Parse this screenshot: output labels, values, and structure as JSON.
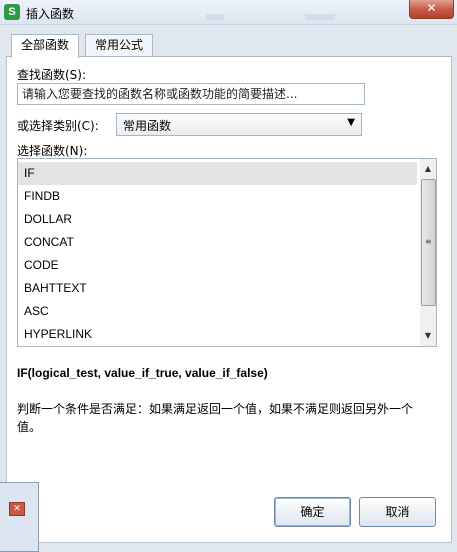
{
  "window": {
    "title": "插入函数",
    "close_glyph": "✕"
  },
  "tabs": [
    {
      "label": "全部函数",
      "active": true
    },
    {
      "label": "常用公式",
      "active": false
    }
  ],
  "search": {
    "label": "查找函数(S):",
    "placeholder": "请输入您要查找的函数名称或函数功能的简要描述..."
  },
  "category": {
    "label": "或选择类别(C):",
    "value": "常用函数"
  },
  "function_list": {
    "label": "选择函数(N):",
    "items": [
      "IF",
      "FINDB",
      "DOLLAR",
      "CONCAT",
      "CODE",
      "BAHTTEXT",
      "ASC",
      "HYPERLINK"
    ],
    "selected": "IF"
  },
  "syntax": "IF(logical_test, value_if_true, value_if_false)",
  "description": "判断一个条件是否满足：如果满足返回一个值，如果不满足则返回另外一个值。",
  "buttons": {
    "ok": "确定",
    "cancel": "取消"
  },
  "icons": {
    "app": "spreadsheet-app-icon",
    "dropdown": "chevron-down-icon",
    "scroll_up": "arrow-up-icon",
    "scroll_down": "arrow-down-icon"
  },
  "colors": {
    "close_button": "#c65743",
    "app_icon": "#2f9a46",
    "selection": "#e3e3e3"
  }
}
